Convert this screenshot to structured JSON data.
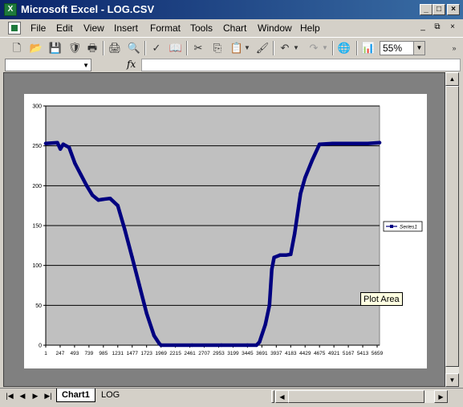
{
  "window": {
    "title": "Microsoft Excel - LOG.CSV",
    "app_icon": "excel-icon",
    "buttons": [
      "minimize",
      "maximize",
      "close"
    ]
  },
  "menubar": {
    "items": [
      "File",
      "Edit",
      "View",
      "Insert",
      "Format",
      "Tools",
      "Chart",
      "Window",
      "Help"
    ]
  },
  "toolbar": {
    "icons": [
      "new-icon",
      "open-icon",
      "save-icon",
      "permission-icon",
      "print-icon",
      "print-preview-icon",
      "spelling-icon",
      "research-icon",
      "cut-icon",
      "copy-icon",
      "paste-icon",
      "format-painter-icon",
      "undo-icon",
      "redo-icon",
      "hyperlink-icon",
      "chart-wizard-icon"
    ],
    "zoom": "55%"
  },
  "formula_bar": {
    "fx_label": "fx",
    "name_box": "",
    "formula": ""
  },
  "chart": {
    "legend_label": "Series1",
    "tooltip": "Plot Area",
    "series_color": "#000080",
    "plot_bg": "#c0c0c0"
  },
  "chart_data": {
    "type": "line",
    "title": "",
    "xlabel": "",
    "ylabel": "",
    "ylim": [
      0,
      300
    ],
    "yticks": [
      0,
      50,
      100,
      150,
      200,
      250,
      300
    ],
    "xticks": [
      "1",
      "247",
      "493",
      "739",
      "985",
      "1231",
      "1477",
      "1723",
      "1969",
      "2215",
      "2461",
      "2707",
      "2953",
      "3199",
      "3445",
      "3691",
      "3937",
      "4183",
      "4429",
      "4675",
      "4921",
      "5167",
      "5413",
      "5659"
    ],
    "grid": true,
    "legend": "right",
    "series": [
      {
        "name": "Series1",
        "x": [
          1,
          200,
          250,
          300,
          400,
          500,
          600,
          700,
          800,
          900,
          985,
          1100,
          1231,
          1350,
          1477,
          1600,
          1723,
          1850,
          1940,
          1969,
          2500,
          3000,
          3445,
          3600,
          3650,
          3750,
          3820,
          3860,
          3900,
          4000,
          4100,
          4183,
          4250,
          4350,
          4429,
          4550,
          4675,
          4900,
          5200,
          5500,
          5700
        ],
        "y": [
          253,
          254,
          246,
          252,
          248,
          228,
          214,
          200,
          188,
          182,
          183,
          184,
          175,
          145,
          110,
          75,
          40,
          12,
          2,
          0,
          0,
          0,
          0,
          0,
          4,
          26,
          50,
          95,
          110,
          113,
          113,
          114,
          140,
          190,
          210,
          232,
          252,
          253,
          253,
          253,
          254
        ]
      }
    ]
  },
  "sheet_tabs": {
    "tabs": [
      "Chart1",
      "LOG"
    ],
    "active": "Chart1"
  }
}
